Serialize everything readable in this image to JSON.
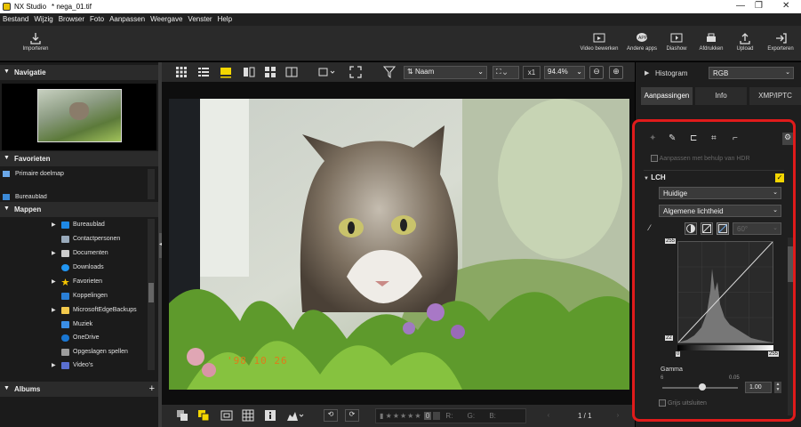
{
  "titlebar": {
    "app": "NX Studio",
    "file": "* nega_01.tif"
  },
  "menu": [
    "Bestand",
    "Wijzig",
    "Browser",
    "Foto",
    "Aanpassen",
    "Weergave",
    "Venster",
    "Help"
  ],
  "toolbar": {
    "import": "Importeren",
    "video": "Video bewerken",
    "apps": "Andere apps",
    "slideshow": "Diashow",
    "print": "Afdrukken",
    "upload": "Upload",
    "export": "Exporteren"
  },
  "left": {
    "navigatie": "Navigatie",
    "favorieten": "Favorieten",
    "fav_items": [
      "Primaire doelmap",
      "Bureaublad"
    ],
    "mappen": "Mappen",
    "folders": [
      "Bureaublad",
      "Contactpersonen",
      "Documenten",
      "Downloads",
      "Favorieten",
      "Koppelingen",
      "MicrosoftEdgeBackups",
      "Muziek",
      "OneDrive",
      "Opgeslagen spellen",
      "Video's"
    ],
    "albums": "Albums"
  },
  "viewer": {
    "sort": "Naam",
    "zoom_x": "x1",
    "zoom_pct": "94.4%",
    "page": "1 / 1",
    "r": "R:",
    "g": "G:",
    "b": "B:",
    "date_stamp": "'98 10 26"
  },
  "right": {
    "histogram": "Histogram",
    "hist_mode": "RGB",
    "tabs": [
      "Aanpassingen",
      "Info",
      "XMP/IPTC"
    ],
    "hdr_label": "Aanpassen met behulp van HDR",
    "lch": "LCH",
    "preset": "Huidige",
    "channel": "Algemene lichtheid",
    "angle": "60°",
    "max_val": "255",
    "min_val": "22",
    "out_low": "0",
    "out_high": "255",
    "gamma_label": "Gamma",
    "gamma_min": "6",
    "gamma_max": "0.05",
    "gamma_val": "1.00",
    "grayscale": "Grijs uitsluiten"
  },
  "colors": {
    "accent_yellow": "#f4d600",
    "highlight_red": "#e01b1b"
  }
}
